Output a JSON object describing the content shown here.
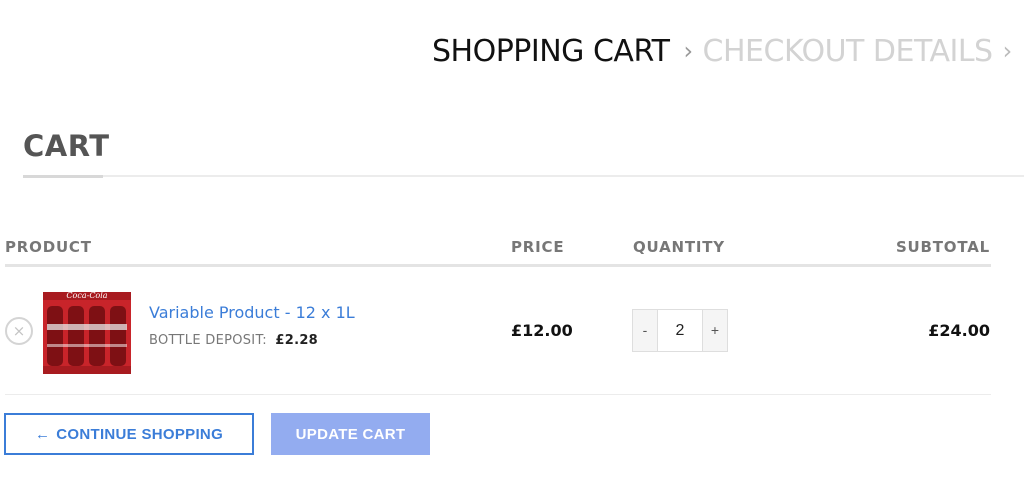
{
  "breadcrumb": {
    "active": "SHOPPING CART",
    "separator": "›",
    "next": "CHECKOUT DETAILS",
    "overflow_separator": "›"
  },
  "cart": {
    "title": "CART"
  },
  "table": {
    "headers": {
      "product": "PRODUCT",
      "price": "PRICE",
      "quantity": "QUANTITY",
      "subtotal": "SUBTOTAL"
    },
    "rows": [
      {
        "remove": "×",
        "name": "Variable Product - 12 x 1L",
        "deposit_label": "BOTTLE DEPOSIT:",
        "deposit_value": "£2.28",
        "price": "£12.00",
        "quantity": "2",
        "qty_minus": "-",
        "qty_plus": "+",
        "subtotal": "£24.00",
        "thumb_label": "Coca-Cola"
      }
    ]
  },
  "actions": {
    "continue_arrow": "←",
    "continue_label": "CONTINUE SHOPPING",
    "update_label": "UPDATE CART"
  },
  "colors": {
    "accent": "#3b7dd8",
    "update_button": "#93acf0",
    "crate_red": "#c8242a"
  }
}
